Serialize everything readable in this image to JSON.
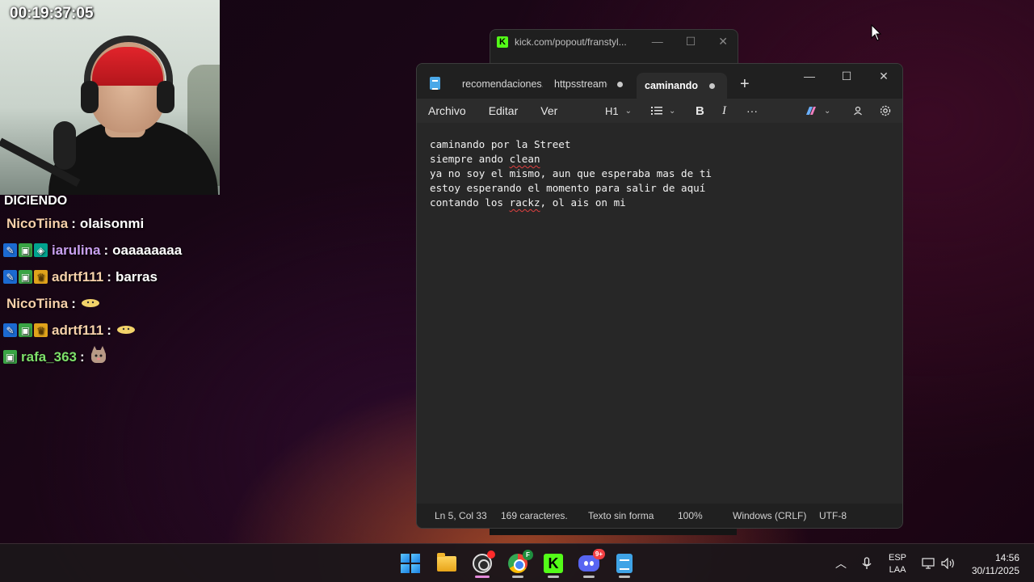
{
  "overlay": {
    "timer": "00:19:37:05",
    "chat_header": "DICIENDO",
    "chat": [
      {
        "user": "NicoTiina",
        "user_color": "#f5d0a9",
        "badges": [],
        "message": "olaisonmi",
        "emote": ""
      },
      {
        "user": "iarulina",
        "user_color": "#c9a0f0",
        "badges": [
          "blue",
          "green",
          "teal"
        ],
        "message": "oaaaaaaaa",
        "emote": ""
      },
      {
        "user": "adrtf111",
        "user_color": "#f5d0a9",
        "badges": [
          "blue",
          "green",
          "gold"
        ],
        "message": "barras",
        "emote": ""
      },
      {
        "user": "NicoTiina",
        "user_color": "#f5d0a9",
        "badges": [],
        "message": "",
        "emote": "emote-blob"
      },
      {
        "user": "adrtf111",
        "user_color": "#f5d0a9",
        "badges": [
          "blue",
          "green",
          "gold"
        ],
        "message": "",
        "emote": "emote-blob"
      },
      {
        "user": "rafa_363",
        "user_color": "#7ee06a",
        "badges": [
          "green"
        ],
        "message": "",
        "emote": "emote-cat"
      }
    ]
  },
  "kick_window": {
    "url": "kick.com/popout/franstyl..."
  },
  "notepad": {
    "tabs": [
      {
        "label": "recomendaciones.t",
        "unsaved": false
      },
      {
        "label": "httpsstreame",
        "unsaved": true
      },
      {
        "label": "caminando p",
        "unsaved": true,
        "active": true
      }
    ],
    "menu": [
      "Archivo",
      "Editar",
      "Ver"
    ],
    "heading_select": "H1",
    "lines": [
      "caminando por la Street",
      "siempre ando clean",
      "ya no soy el mismo, aun que esperaba mas de ti",
      "estoy esperando el momento para salir de aquí",
      "contando los rackz, ol ais on mi"
    ],
    "status": {
      "position": "Ln 5, Col 33",
      "chars": "169 caracteres.",
      "format": "Texto sin forma",
      "zoom": "100%",
      "line_ending": "Windows (CRLF)",
      "encoding": "UTF-8"
    }
  },
  "taskbar": {
    "apps": [
      "windows-start",
      "file-explorer",
      "obs-studio",
      "chrome",
      "kick",
      "discord",
      "notepad"
    ],
    "chrome_badge": "F",
    "discord_badge": "9+",
    "lang_1": "ESP",
    "lang_2": "LAA",
    "time": "14:56",
    "date": "30/11/2025"
  },
  "colors": {
    "notepad_bg": "#202020",
    "kick_green": "#53fc18",
    "accent_blue": "#1a7fe0"
  }
}
